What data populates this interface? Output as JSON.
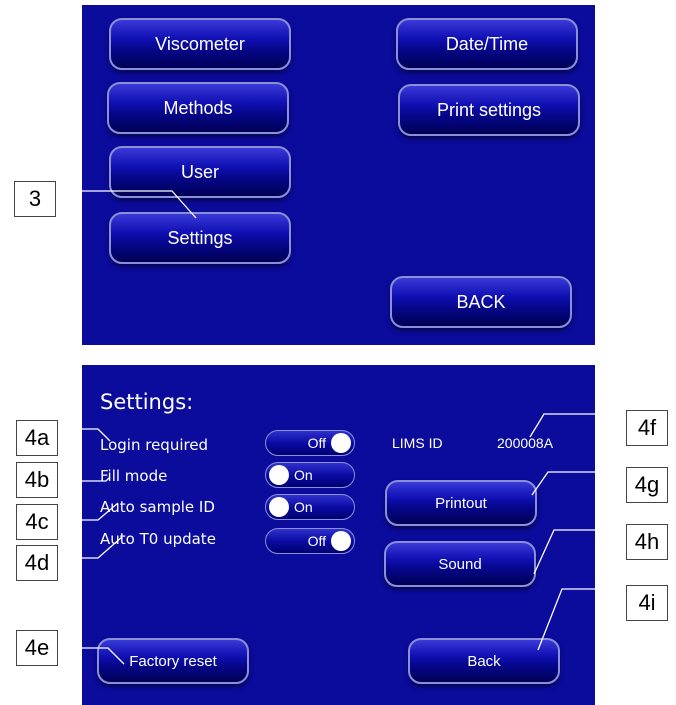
{
  "top_screen": {
    "buttons": {
      "viscometer": "Viscometer",
      "date_time": "Date/Time",
      "methods": "Methods",
      "print_settings": "Print settings",
      "user": "User",
      "settings": "Settings",
      "back": "BACK"
    }
  },
  "settings_screen": {
    "title": "Settings:",
    "rows": {
      "login_required": {
        "label": "Login required",
        "toggle": "Off"
      },
      "fill_mode": {
        "label": "Fill mode",
        "toggle": "On"
      },
      "auto_sample_id": {
        "label": "Auto sample ID",
        "toggle": "On"
      },
      "auto_t0_update": {
        "label": "Auto T0 update",
        "toggle": "Off"
      }
    },
    "lims_label": "LIMS ID",
    "lims_value": "200008A",
    "buttons": {
      "printout": "Printout",
      "sound": "Sound",
      "factory_reset": "Factory reset",
      "back": "Back"
    }
  },
  "callouts": {
    "c3": "3",
    "c4a": "4a",
    "c4b": "4b",
    "c4c": "4c",
    "c4d": "4d",
    "c4e": "4e",
    "c4f": "4f",
    "c4g": "4g",
    "c4h": "4h",
    "c4i": "4i"
  }
}
